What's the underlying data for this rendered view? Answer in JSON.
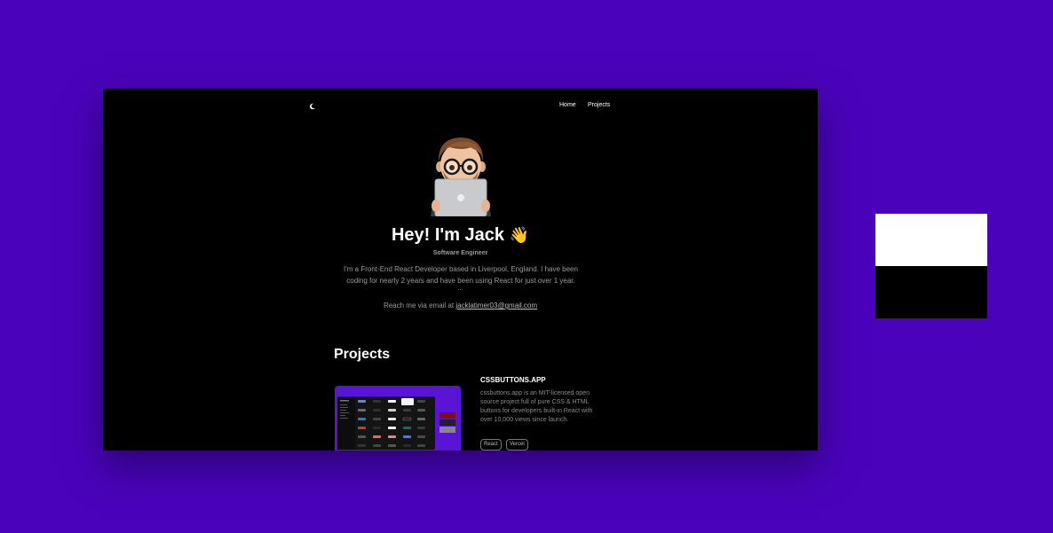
{
  "nav": {
    "theme_toggle_icon": "moon-icon",
    "links": [
      "Home",
      "Projects"
    ]
  },
  "hero": {
    "avatar_icon": "memoji-with-laptop",
    "title": "Hey! I'm Jack",
    "title_emoji": "👋",
    "subtitle": "Software Engineer",
    "bio": "I'm a Front-End React Developer based in Liverpool, England. I have been coding for nearly 2 years and have been using React for just over 1 year.",
    "dots": "...",
    "contact_prefix": "Reach me via email at ",
    "email": "jacklatimer03@gmail.com"
  },
  "projects": {
    "heading": "Projects",
    "items": [
      {
        "title": "CSSBUTTONS.APP",
        "description": "cssbuttons.app is an MIT-licensed open source project full of pure CSS & HTML buttons for developers built-in React with over 10,000 views since launch.",
        "tags": [
          "React",
          "Vercel"
        ]
      }
    ]
  },
  "theme_swatches": {
    "light": "#ffffff",
    "dark": "#000000"
  },
  "colors": {
    "background": "#4a03bb",
    "page": "#000000",
    "accent": "#5a14d6"
  }
}
